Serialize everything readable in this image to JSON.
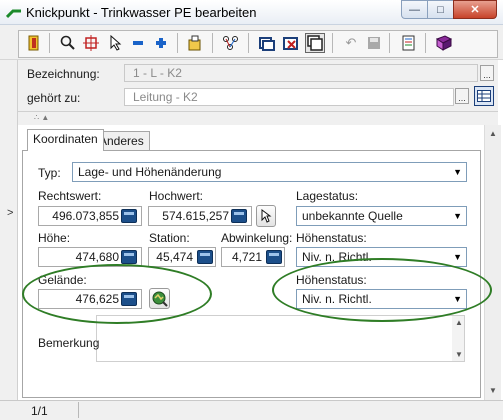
{
  "window": {
    "title": "Knickpunkt - Trinkwasser PE bearbeiten",
    "minimize_icon": "minimize-icon",
    "maximize_icon": "maximize-icon",
    "close_icon": "close-icon"
  },
  "toolbar": {
    "icons": [
      "exit-icon",
      "zoom-icon",
      "crosshair-icon",
      "pointer-icon",
      "minus-icon",
      "plus-icon",
      "edit-icon",
      "network-icon",
      "window-icon",
      "window-delete-icon",
      "window-restore-icon",
      "undo-icon",
      "save-icon",
      "print-icon",
      "book-icon"
    ]
  },
  "properties": {
    "bezeichnung_label": "Bezeichnung:",
    "bezeichnung_value": "1 - L - K2",
    "gehoert_zu_label": "gehört zu:",
    "gehoert_zu_value": "Leitung - K2",
    "more_label": "...",
    "splitter_grip": "∴ ▲"
  },
  "tabs": [
    {
      "label": "Koordinaten",
      "active": true
    },
    {
      "label": "Anderes",
      "active": false
    }
  ],
  "koordinaten": {
    "typ_label": "Typ:",
    "typ_value": "Lage- und Höhenänderung",
    "rechtswert_label": "Rechtswert:",
    "rechtswert_value": "496.073,855",
    "hochwert_label": "Hochwert:",
    "hochwert_value": "574.615,257",
    "lagestatus_label": "Lagestatus:",
    "lagestatus_value": "unbekannte Quelle",
    "hoehe_label": "Höhe:",
    "hoehe_value": "474,680",
    "station_label": "Station:",
    "station_value": "45,474",
    "abwinkelung_label": "Abwinkelung:",
    "abwinkelung_value": "4,721",
    "hoehenstatus_label": "Höhenstatus:",
    "hoehenstatus_value": "Niv. n. Richtl.",
    "gelaende_label": "Gelände:",
    "gelaende_value": "476,625",
    "hoehenstatus2_label": "Höhenstatus:",
    "hoehenstatus2_value": "Niv. n. Richtl.",
    "bemerkung_label": "Bemerkung",
    "bemerkung_value": ""
  },
  "row_marker": ">",
  "status": {
    "page": "1/1"
  },
  "colors": {
    "annotation": "#2f7d26",
    "calc_button": "#1c4f8a"
  }
}
